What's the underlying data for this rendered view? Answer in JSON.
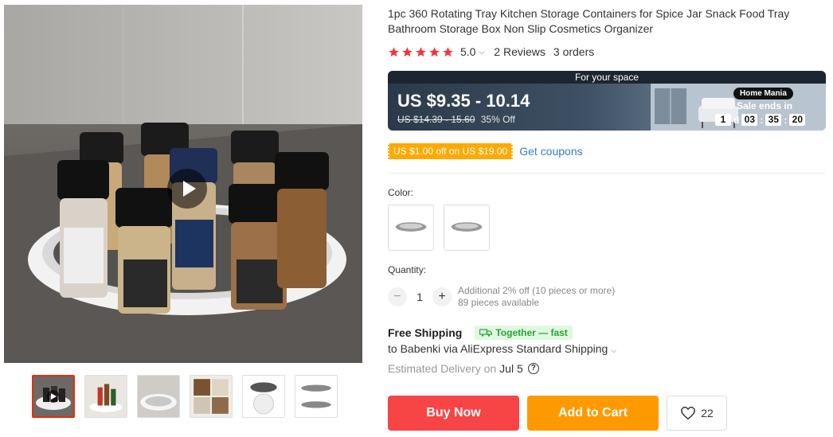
{
  "product": {
    "title": "1pc 360 Rotating Tray Kitchen Storage Containers for Spice Jar Snack Food Tray Bathroom Storage Box Non Slip Cosmetics Organizer",
    "rating": "5.0",
    "reviews": "2 Reviews",
    "orders": "3 orders"
  },
  "gallery": {
    "thumbnails": [
      "video-thumb",
      "thumb-2",
      "thumb-3",
      "thumb-4",
      "thumb-5",
      "thumb-6"
    ],
    "active_index": 0
  },
  "banner": {
    "title": "For your space",
    "price": "US $9.35 - 10.14",
    "old_price": "US $14.39 - 15.60",
    "discount": "35% Off",
    "store": "Home Mania",
    "sale_ends": "Sale ends in",
    "timer": {
      "days": "1",
      "d": "d",
      "h": "03",
      "m": "35",
      "s": "20",
      "sep": ":"
    }
  },
  "coupon": {
    "tag": "US $1.00 off on US $19.00",
    "link": "Get coupons"
  },
  "color": {
    "label": "Color:",
    "options": [
      "color-option-1",
      "color-option-2"
    ]
  },
  "quantity": {
    "label": "Quantity:",
    "minus": "−",
    "value": "1",
    "plus": "+",
    "discount_note": "Additional 2% off (10 pieces or more)",
    "available": "89 pieces available"
  },
  "shipping": {
    "title": "Free Shipping",
    "badge": "Together — fast",
    "to": "to Babenki via AliExpress Standard Shipping",
    "estimated_label": "Estimated Delivery on",
    "date": "Jul 5",
    "help": "?"
  },
  "actions": {
    "buy_now": "Buy Now",
    "add_to_cart": "Add to Cart",
    "wishlist_count": "22"
  },
  "colors": {
    "accent_red": "#f74546",
    "accent_orange": "#fe9a00",
    "star": "#f5343d",
    "coupon": "#fea901",
    "link_blue": "#3a7bbf",
    "green": "#22a832"
  }
}
